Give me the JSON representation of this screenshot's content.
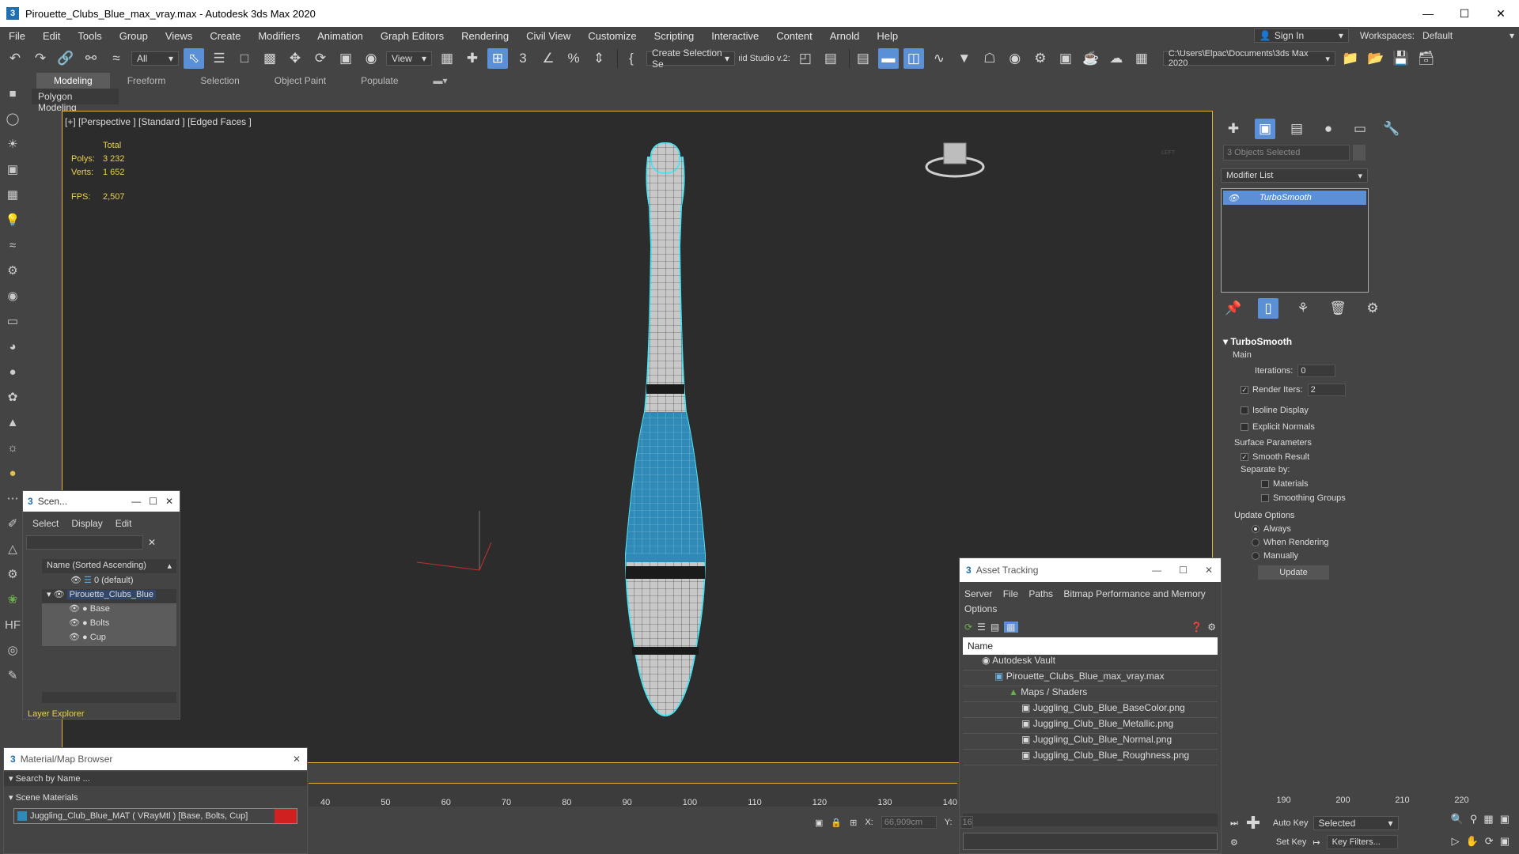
{
  "window": {
    "title": "Pirouette_Clubs_Blue_max_vray.max - Autodesk 3ds Max 2020",
    "app_icon": "3"
  },
  "menu": [
    "File",
    "Edit",
    "Tools",
    "Group",
    "Views",
    "Create",
    "Modifiers",
    "Animation",
    "Graph Editors",
    "Rendering",
    "Civil View",
    "Customize",
    "Scripting",
    "Interactive",
    "Content",
    "Arnold",
    "Help"
  ],
  "signin": {
    "label": "Sign In",
    "workspaces_label": "Workspaces:",
    "workspace": "Default"
  },
  "toolbar": {
    "filter": "All",
    "ref_coord": "View",
    "selection_set": "Create Selection Se",
    "studio": "ıid Studio v.2:",
    "project_path": "C:\\Users\\Elpac\\Documents\\3ds Max 2020"
  },
  "ribbon": {
    "tabs": [
      "Modeling",
      "Freeform",
      "Selection",
      "Object Paint",
      "Populate"
    ],
    "active": "Modeling",
    "sub": "Polygon Modeling"
  },
  "viewport": {
    "label": "[+] [Perspective ] [Standard ] [Edged Faces ]",
    "stats": {
      "total_label": "Total",
      "polys_label": "Polys:",
      "polys": "3 232",
      "verts_label": "Verts:",
      "verts": "1 652",
      "fps_label": "FPS:",
      "fps": "2,507"
    },
    "viewcube_label": "LEFT"
  },
  "command_panel": {
    "selected": "3 Objects Selected",
    "modifier_list": "Modifier List",
    "stack": [
      "TurboSmooth"
    ],
    "rollout": {
      "title": "TurboSmooth",
      "main": "Main",
      "iterations_label": "Iterations:",
      "iterations": "0",
      "render_iters_label": "Render Iters:",
      "render_iters": "2",
      "isoline": "Isoline Display",
      "explicit": "Explicit Normals",
      "surface_params": "Surface Parameters",
      "smooth_result": "Smooth Result",
      "separate_by": "Separate by:",
      "materials": "Materials",
      "smoothing_groups": "Smoothing Groups",
      "update_options": "Update Options",
      "always": "Always",
      "when_rendering": "When Rendering",
      "manually": "Manually",
      "update_btn": "Update"
    }
  },
  "scene_explorer": {
    "title": "Scen...",
    "menu": [
      "Select",
      "Display",
      "Edit"
    ],
    "column": "Name (Sorted Ascending)",
    "rows": [
      {
        "name": "0 (default)",
        "indent": 0
      },
      {
        "name": "Pirouette_Clubs_Blue",
        "indent": 0
      },
      {
        "name": "Base",
        "indent": 1
      },
      {
        "name": "Bolts",
        "indent": 1
      },
      {
        "name": "Cup",
        "indent": 1
      }
    ],
    "footer": "Layer Explorer"
  },
  "material_browser": {
    "title": "Material/Map Browser",
    "search": "Search by Name ...",
    "section": "Scene Materials",
    "item": "Juggling_Club_Blue_MAT ( VRayMtl ) [Base, Bolts, Cup]"
  },
  "asset_tracking": {
    "title": "Asset Tracking",
    "menu": [
      "Server",
      "File",
      "Paths",
      "Bitmap Performance and Memory",
      "Options"
    ],
    "column": "Name",
    "rows": [
      {
        "name": "Autodesk Vault",
        "indent": 1
      },
      {
        "name": "Pirouette_Clubs_Blue_max_vray.max",
        "indent": 2
      },
      {
        "name": "Maps / Shaders",
        "indent": 3
      },
      {
        "name": "Juggling_Club_Blue_BaseColor.png",
        "indent": 4
      },
      {
        "name": "Juggling_Club_Blue_Metallic.png",
        "indent": 4
      },
      {
        "name": "Juggling_Club_Blue_Normal.png",
        "indent": 4
      },
      {
        "name": "Juggling_Club_Blue_Roughness.png",
        "indent": 4
      }
    ]
  },
  "timeline": {
    "ticks": [
      "40",
      "50",
      "60",
      "70",
      "80",
      "90",
      "100",
      "110",
      "120",
      "130",
      "140"
    ],
    "ticks_right": [
      "190",
      "200",
      "210",
      "220"
    ]
  },
  "status": {
    "x_label": "X:",
    "x_value": "66,909cm",
    "y_label": "Y:",
    "y_value": "16"
  },
  "anim": {
    "auto_key": "Auto Key",
    "selected": "Selected",
    "set_key": "Set Key",
    "key_filters": "Key Filters..."
  }
}
